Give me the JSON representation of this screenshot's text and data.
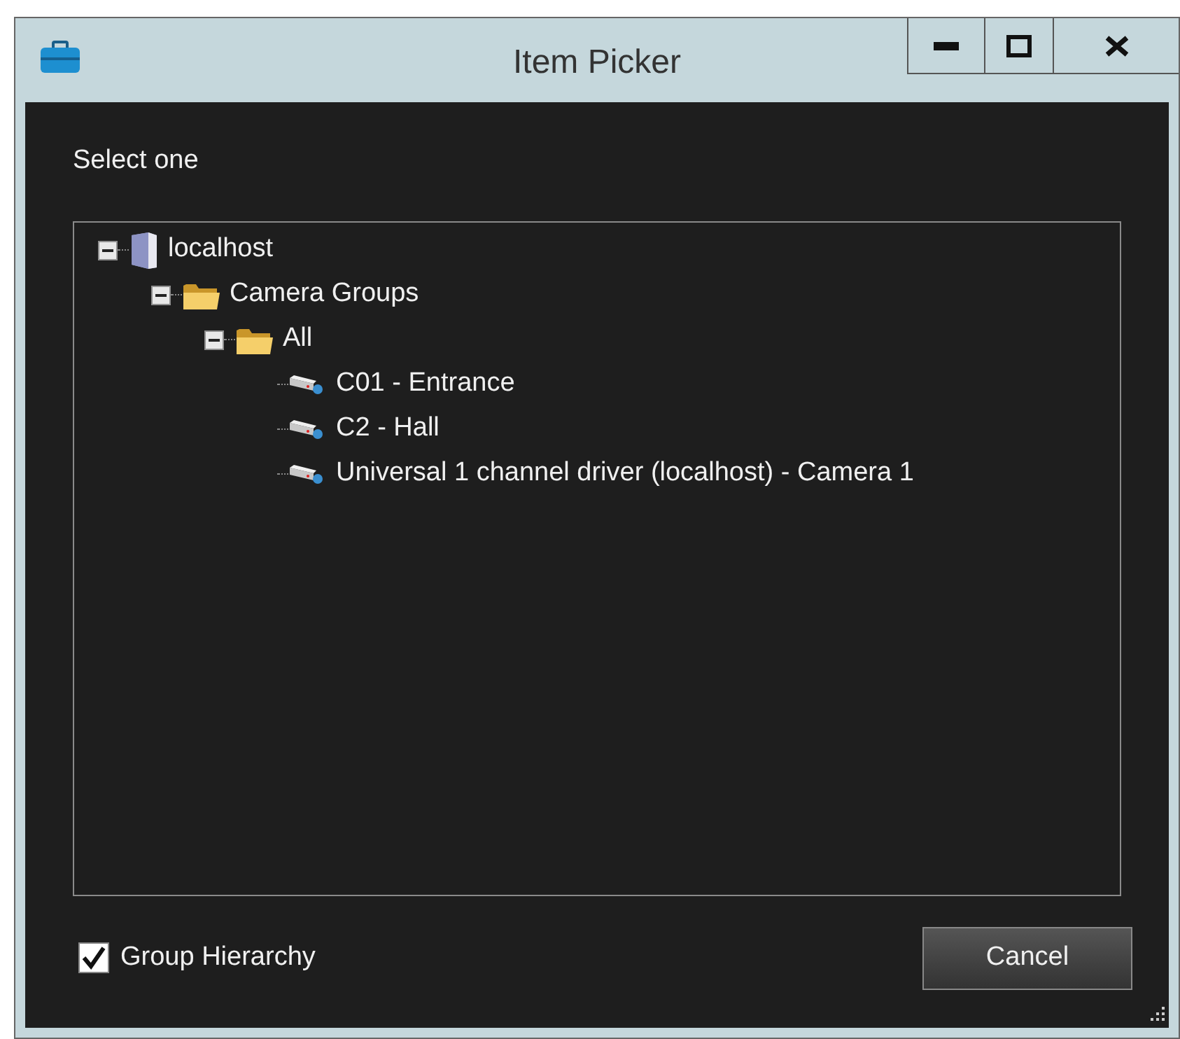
{
  "window": {
    "title": "Item Picker"
  },
  "prompt": "Select one",
  "tree": [
    {
      "kind": "server",
      "label": "localhost",
      "expanded": true,
      "children": [
        {
          "kind": "folder",
          "label": "Camera Groups",
          "expanded": true,
          "children": [
            {
              "kind": "folder",
              "label": "All",
              "expanded": true,
              "children": [
                {
                  "kind": "camera",
                  "label": "C01 - Entrance"
                },
                {
                  "kind": "camera",
                  "label": "C2 - Hall"
                },
                {
                  "kind": "camera",
                  "label": "Universal 1 channel driver (localhost) - Camera 1"
                }
              ]
            }
          ]
        }
      ]
    }
  ],
  "group_hierarchy": {
    "label": "Group Hierarchy",
    "checked": true
  },
  "buttons": [
    "Cancel"
  ]
}
